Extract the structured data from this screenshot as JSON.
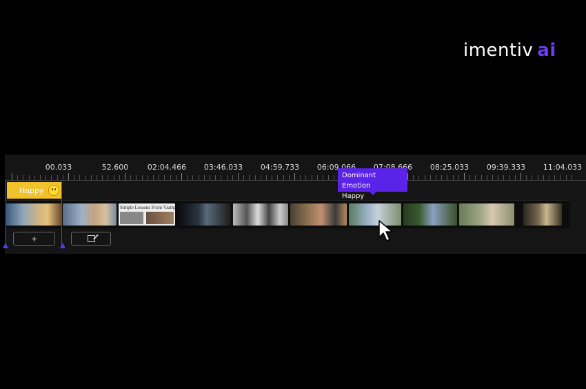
{
  "brand": {
    "name": "imentiv",
    "suffix": "ai",
    "accent_color": "#6d3df5"
  },
  "timeline": {
    "timestamps": [
      "00.033",
      "52.600",
      "02:04.466",
      "03:46.033",
      "04:59.733",
      "06:09.066",
      "07:08.666",
      "08:25.033",
      "09:39.333",
      "11:04.033"
    ],
    "emotion_tag": {
      "label": "Happy",
      "icon": "smiley-icon",
      "color": "#f0c22b"
    },
    "tooltip": {
      "title": "Dominant Emotion",
      "value": "Happy"
    },
    "selection_color": "#4b3df0"
  },
  "frames": [
    {
      "caption": ""
    },
    {
      "caption": ""
    },
    {
      "caption": "Simple Lessons From 'Gump'"
    },
    {
      "caption": ""
    },
    {
      "caption": ""
    },
    {
      "caption": ""
    },
    {
      "caption": ""
    },
    {
      "caption": ""
    },
    {
      "caption": ""
    },
    {
      "caption": ""
    }
  ],
  "controls": {
    "add_label": "+",
    "add_icon": "plus-icon",
    "edit_icon": "edit-icon"
  },
  "cursor_icon": "pointer-cursor-icon"
}
